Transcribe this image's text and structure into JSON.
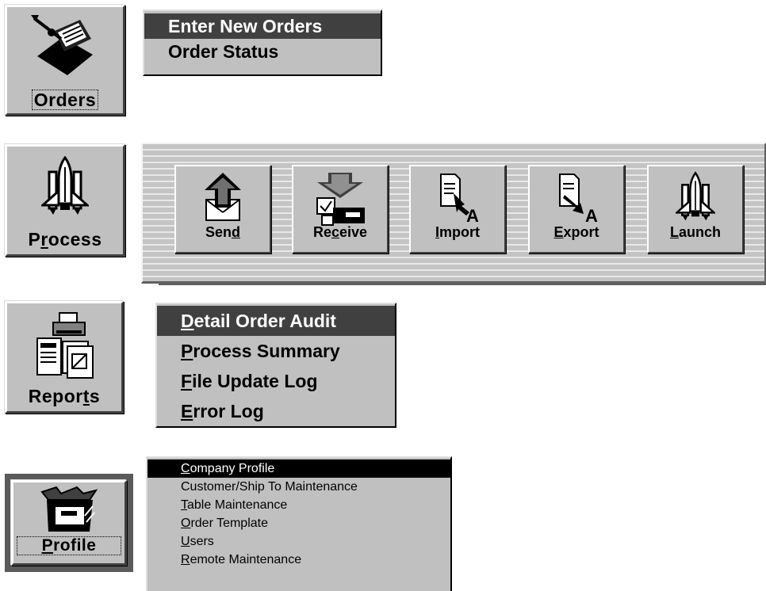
{
  "orders": {
    "button_label": "Orders",
    "menu": [
      "Enter New Orders",
      "Order Status"
    ],
    "selected_index": 0
  },
  "process": {
    "button_label_parts": [
      "P",
      "r",
      "ocess"
    ],
    "toolbar": [
      {
        "pre": "Sen",
        "ul": "d",
        "post": "",
        "icon": "send-icon"
      },
      {
        "pre": "Re",
        "ul": "c",
        "post": "eive",
        "icon": "receive-icon"
      },
      {
        "pre": "",
        "ul": "I",
        "post": "mport",
        "icon": "import-icon"
      },
      {
        "pre": "",
        "ul": "E",
        "post": "xport",
        "icon": "export-icon"
      },
      {
        "pre": "",
        "ul": "L",
        "post": "aunch",
        "icon": "launch-icon"
      }
    ]
  },
  "reports": {
    "button_label_parts": [
      "Repor",
      "t",
      "s"
    ],
    "menu": [
      {
        "ul": "D",
        "rest": "etail Order Audit"
      },
      {
        "ul": "P",
        "rest": "rocess Summary"
      },
      {
        "ul": "F",
        "rest": "ile Update Log"
      },
      {
        "ul": "E",
        "rest": "rror Log"
      }
    ],
    "selected_index": 0
  },
  "profile": {
    "button_label_parts": [
      "P",
      "rofile"
    ],
    "menu": [
      {
        "ul": "C",
        "rest": "ompany Profile"
      },
      {
        "ul": "",
        "rest": "Customer/Ship To Maintenance"
      },
      {
        "ul": "T",
        "rest": "able Maintenance"
      },
      {
        "ul": "O",
        "rest": "rder Template"
      },
      {
        "ul": "U",
        "rest": "sers"
      },
      {
        "ul": "R",
        "rest": "emote Maintenance"
      }
    ],
    "selected_index": 0
  }
}
